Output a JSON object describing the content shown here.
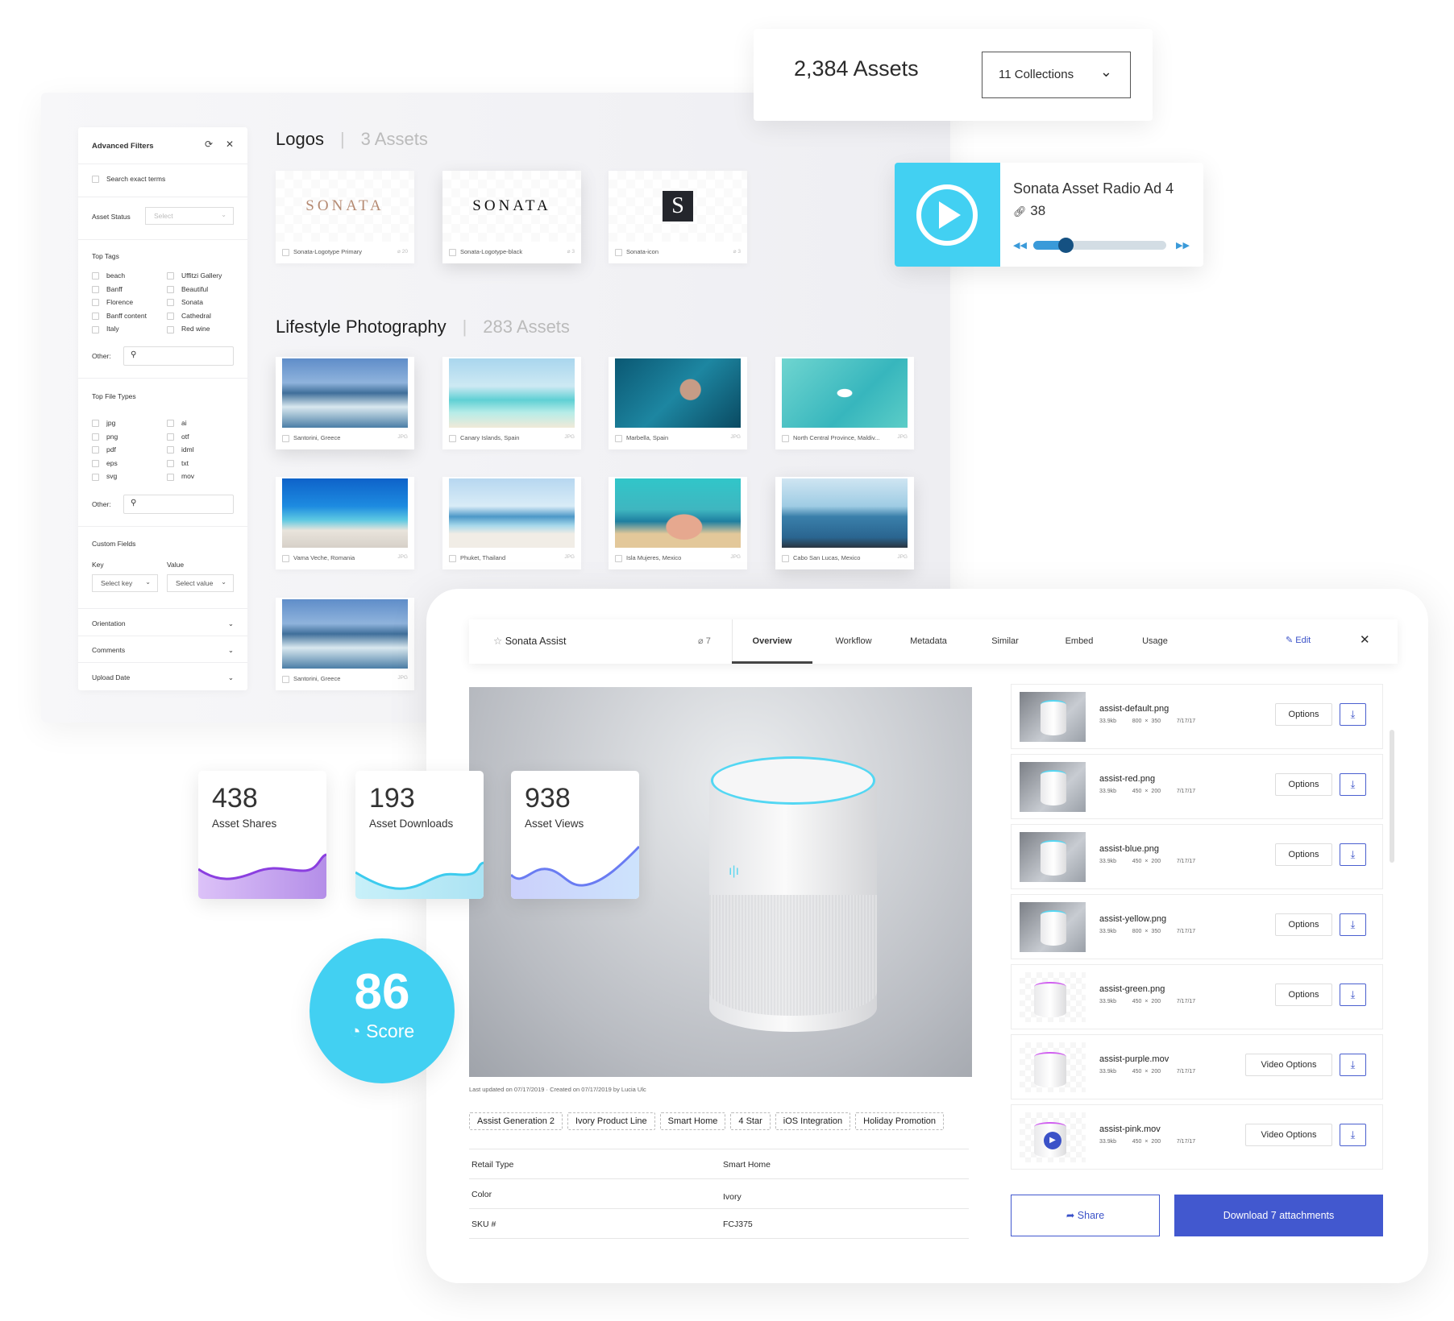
{
  "filters": {
    "title": "Advanced Filters",
    "search_exact": "Search exact terms",
    "asset_status_label": "Asset Status",
    "asset_status_placeholder": "Select",
    "top_tags_label": "Top Tags",
    "tags_left": [
      "beach",
      "Banff",
      "Florence",
      "Banff content",
      "Italy"
    ],
    "tags_right": [
      "Uffitzi Gallery",
      "Beautiful",
      "Sonata",
      "Cathedral",
      "Red wine"
    ],
    "other_label": "Other:",
    "top_file_types_label": "Top File Types",
    "types_left": [
      "jpg",
      "png",
      "pdf",
      "eps",
      "svg"
    ],
    "types_right": [
      "ai",
      "otf",
      "idml",
      "txt",
      "mov"
    ],
    "custom_fields_label": "Custom Fields",
    "key_label": "Key",
    "value_label": "Value",
    "key_placeholder": "Select key",
    "value_placeholder": "Select value",
    "accordions": [
      "Orientation",
      "Comments",
      "Upload Date"
    ]
  },
  "logos": {
    "title": "Logos",
    "count": "3 Assets",
    "items": [
      {
        "name": "Sonata-Logotype Primary",
        "links": "20",
        "logo_text": "SONATA"
      },
      {
        "name": "Sonata-Logotype-black",
        "links": "3",
        "logo_text": "SONATA"
      },
      {
        "name": "Sonata-icon",
        "links": "3",
        "logo_text": "S"
      }
    ]
  },
  "lifestyle": {
    "title": "Lifestyle Photography",
    "count": "283 Assets",
    "items": [
      {
        "name": "Santorini, Greece",
        "ext": "JPG"
      },
      {
        "name": "Canary Islands, Spain",
        "ext": "JPG"
      },
      {
        "name": "Marbella, Spain",
        "ext": "JPG"
      },
      {
        "name": "North Central Province, Maldiv...",
        "ext": "JPG"
      },
      {
        "name": "Vama Veche, Romania",
        "ext": "JPG"
      },
      {
        "name": "Phuket, Thailand",
        "ext": "JPG"
      },
      {
        "name": "Isla Mujeres, Mexico",
        "ext": "JPG"
      },
      {
        "name": "Cabo San Lucas, Mexico",
        "ext": "JPG"
      },
      {
        "name": "Santorini, Greece",
        "ext": "JPG"
      }
    ]
  },
  "summary": {
    "assets": "2,384 Assets",
    "collections": "11 Collections"
  },
  "radio": {
    "title": "Sonata Asset Radio Ad 4",
    "links": "38",
    "progress": 0.24,
    "accent": "#42d0f2"
  },
  "detail": {
    "title": "Sonata Assist",
    "links": "7",
    "tabs": [
      "Overview",
      "Workflow",
      "Metadata",
      "Similar",
      "Embed",
      "Usage"
    ],
    "active_tab": "Overview",
    "edit": "Edit",
    "updated": "Last updated on 07/17/2019 · Created on 07/17/2019 by Lucia Ulc",
    "tags": [
      "Assist Generation 2",
      "Ivory Product Line",
      "Smart Home",
      "4 Star",
      "iOS Integration",
      "Holiday Promotion"
    ],
    "metadata": [
      {
        "key": "Retail Type",
        "value": "Smart Home"
      },
      {
        "key": "Color",
        "value": "Ivory"
      },
      {
        "key": "SKU #",
        "value": "FCJ375"
      }
    ],
    "files": [
      {
        "name": "assist-default.png",
        "size": "33.9kb",
        "dims": "800 × 350",
        "date": "7/17/17",
        "action": "Options"
      },
      {
        "name": "assist-red.png",
        "size": "33.9kb",
        "dims": "450 × 200",
        "date": "7/17/17",
        "action": "Options"
      },
      {
        "name": "assist-blue.png",
        "size": "33.9kb",
        "dims": "450 × 200",
        "date": "7/17/17",
        "action": "Options"
      },
      {
        "name": "assist-yellow.png",
        "size": "33.9kb",
        "dims": "800 × 350",
        "date": "7/17/17",
        "action": "Options"
      },
      {
        "name": "assist-green.png",
        "size": "33.9kb",
        "dims": "450 × 200",
        "date": "7/17/17",
        "action": "Options"
      },
      {
        "name": "assist-purple.mov",
        "size": "33.9kb",
        "dims": "450 × 200",
        "date": "7/17/17",
        "action": "Video Options"
      },
      {
        "name": "assist-pink.mov",
        "size": "33.9kb",
        "dims": "450 × 200",
        "date": "7/17/17",
        "action": "Video Options"
      }
    ],
    "share": "Share",
    "download": "Download 7 attachments",
    "brand_color": "#4258cf"
  },
  "stats": [
    {
      "value": "438",
      "label": "Asset Shares",
      "color": "#8b3fe0"
    },
    {
      "value": "193",
      "label": "Asset Downloads",
      "color": "#3ccbee"
    },
    {
      "value": "938",
      "label": "Asset Views",
      "color": "#6a7cf2"
    }
  ],
  "score": {
    "value": "86",
    "label": "Score",
    "color": "#42d0f2"
  }
}
